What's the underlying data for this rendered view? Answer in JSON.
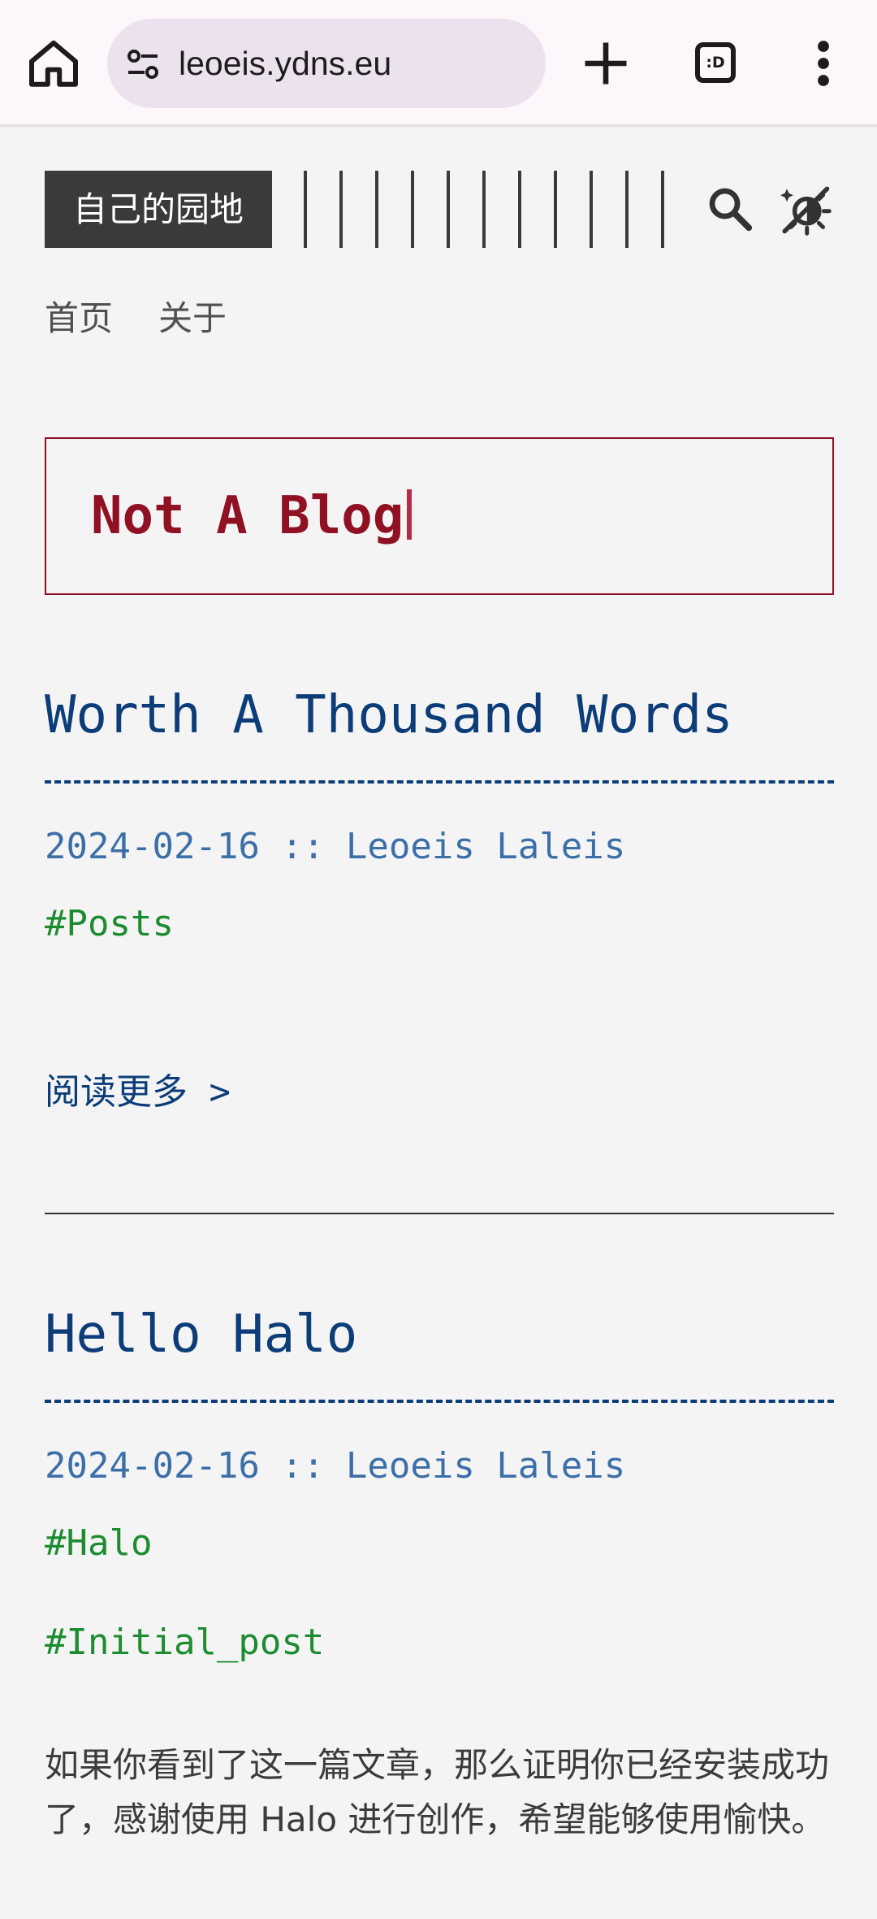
{
  "browser": {
    "url": "leoeis.ydns.eu",
    "tab_count": ":D"
  },
  "site": {
    "logo": "自己的园地",
    "nav": [
      "首页",
      "关于"
    ],
    "banner_text": "Not A Blog"
  },
  "posts": [
    {
      "title": "Worth A Thousand Words",
      "meta": "2024-02-16 :: Leoeis Laleis",
      "tags": [
        "#Posts"
      ],
      "read_more": "阅读更多 >"
    },
    {
      "title": "Hello Halo",
      "meta": "2024-02-16 :: Leoeis Laleis",
      "tags": [
        "#Halo",
        "#Initial_post"
      ],
      "excerpt": "如果你看到了这一篇文章，那么证明你已经安装成功了，感谢使用 Halo 进行创作，希望能够使用愉快。"
    }
  ],
  "colors": {
    "accent_title": "#0c3d78",
    "meta": "#3c6fa8",
    "tag": "#1d8c31",
    "banner": "#8f1123",
    "logo_bg": "#3a3a3a"
  },
  "icons": {
    "home": "home-icon",
    "site_settings": "tune-icon",
    "new_tab": "plus-icon",
    "tabs": "tab-switcher-icon",
    "menu": "more-vert-icon",
    "search": "search-icon",
    "theme": "theme-toggle-icon"
  }
}
